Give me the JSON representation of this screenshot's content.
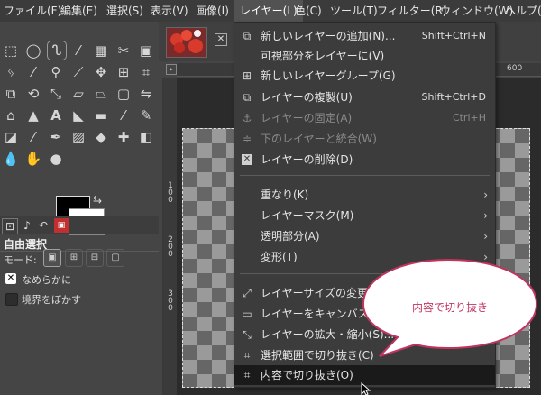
{
  "menubar": {
    "items": [
      "ファイル(F)",
      "編集(E)",
      "選択(S)",
      "表示(V)",
      "画像(I)",
      "レイヤー(L)",
      "色(C)",
      "ツール(T)",
      "フィルター(R)",
      "ウィンドウ(W)",
      "ヘルプ(H"
    ]
  },
  "layer_menu": {
    "items": [
      {
        "label": "新しいレイヤーの追加(N)...",
        "shortcut": "Shift+Ctrl+N",
        "icon": "new-layer-icon"
      },
      {
        "label": "可視部分をレイヤーに(V)",
        "shortcut": "",
        "icon": ""
      },
      {
        "label": "新しいレイヤーグループ(G)",
        "shortcut": "",
        "icon": "new-group-icon"
      },
      {
        "label": "レイヤーの複製(U)",
        "shortcut": "Shift+Ctrl+D",
        "icon": "duplicate-icon"
      },
      {
        "label": "レイヤーの固定(A)",
        "shortcut": "Ctrl+H",
        "icon": "anchor-icon"
      },
      {
        "label": "下のレイヤーと統合(W)",
        "shortcut": "",
        "icon": "merge-down-icon"
      },
      {
        "label": "レイヤーの削除(D)",
        "shortcut": "",
        "icon": "delete-icon"
      },
      {
        "label": "重なり(K)",
        "shortcut": "",
        "icon": ""
      },
      {
        "label": "レイヤーマスク(M)",
        "shortcut": "",
        "icon": ""
      },
      {
        "label": "透明部分(A)",
        "shortcut": "",
        "icon": ""
      },
      {
        "label": "変形(T)",
        "shortcut": "",
        "icon": ""
      },
      {
        "label": "レイヤーサイズの変更(O",
        "shortcut": "",
        "icon": "layer-boundary-icon"
      },
      {
        "label": "レイヤーをキャンバスに合",
        "shortcut": "",
        "icon": "layer-to-canvas-icon"
      },
      {
        "label": "レイヤーの拡大・縮小(S)...",
        "shortcut": "",
        "icon": "scale-layer-icon"
      },
      {
        "label": "選択範囲で切り抜き(C)",
        "shortcut": "",
        "icon": "crop-selection-icon"
      },
      {
        "label": "内容で切り抜き(O)",
        "shortcut": "",
        "icon": "crop-content-icon"
      }
    ]
  },
  "tool_options": {
    "title": "自由選択",
    "mode_label": "モード:",
    "antialias_label": "なめらかに",
    "feather_label": "境界をぼかす"
  },
  "ruler": {
    "h_label": "600",
    "v_labels": [
      "100",
      "200",
      "300"
    ]
  },
  "callout": {
    "text": "内容で切り抜き",
    "color": "#c0345e"
  },
  "colors": {
    "menu_bg": "#3c3c3c",
    "highlight": "#1a1a1a",
    "menubar_active": "#525252"
  }
}
